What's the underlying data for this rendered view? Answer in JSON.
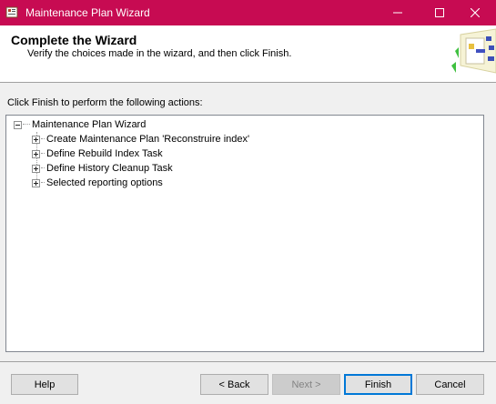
{
  "window": {
    "title": "Maintenance Plan Wizard",
    "accent_color": "#c70b52"
  },
  "header": {
    "title": "Complete the Wizard",
    "subtitle": "Verify the choices made in the wizard, and then click Finish."
  },
  "instruction": "Click Finish to perform the following actions:",
  "tree": {
    "root": {
      "label": "Maintenance Plan Wizard",
      "expanded": true
    },
    "children": [
      {
        "label": "Create Maintenance Plan 'Reconstruire index'",
        "expanded": false
      },
      {
        "label": "Define Rebuild Index Task",
        "expanded": false
      },
      {
        "label": "Define History Cleanup Task",
        "expanded": false
      },
      {
        "label": "Selected reporting options",
        "expanded": false
      }
    ]
  },
  "buttons": {
    "help": "Help",
    "back": "< Back",
    "next": "Next >",
    "finish": "Finish",
    "cancel": "Cancel"
  }
}
